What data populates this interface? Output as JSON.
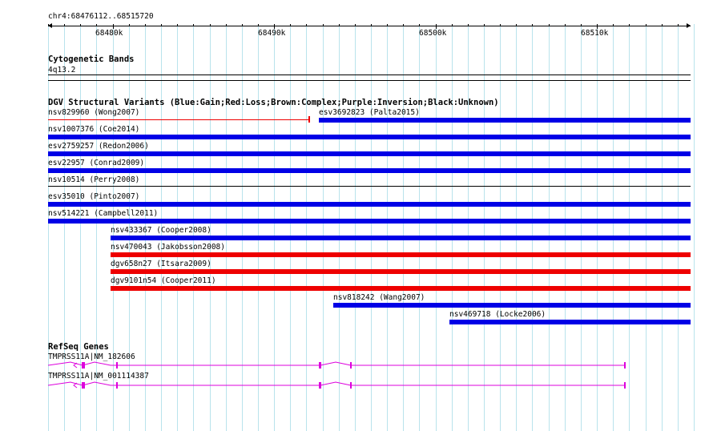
{
  "ruler": {
    "location": "chr4:68476112..68515720",
    "ticks": [
      "68480k",
      "68490k",
      "68500k",
      "68510k"
    ]
  },
  "cytoband": {
    "title": "Cytogenetic Bands",
    "band": "4q13.2"
  },
  "dgv": {
    "title": "DGV Structural Variants (Blue:Gain;Red:Loss;Brown:Complex;Purple:Inversion;Black:Unknown)",
    "colors": {
      "gain": "#0000e6",
      "loss": "#ee0000",
      "unknown": "#000000"
    },
    "variants": [
      {
        "label": "nsv829960 (Wong2007)",
        "type": "loss-thin"
      },
      {
        "label": "esv3692823 (Palta2015)",
        "type": "gain"
      },
      {
        "label": "nsv1007376 (Coe2014)",
        "type": "gain"
      },
      {
        "label": "esv2759257 (Redon2006)",
        "type": "gain"
      },
      {
        "label": "esv22957 (Conrad2009)",
        "type": "gain"
      },
      {
        "label": "nsv10514 (Perry2008)",
        "type": "unknown"
      },
      {
        "label": "esv35010 (Pinto2007)",
        "type": "gain"
      },
      {
        "label": "nsv514221 (Campbell2011)",
        "type": "gain"
      },
      {
        "label": "nsv433367 (Cooper2008)",
        "type": "gain"
      },
      {
        "label": "nsv470043 (Jakobsson2008)",
        "type": "loss"
      },
      {
        "label": "dgv658n27 (Itsara2009)",
        "type": "loss"
      },
      {
        "label": "dgv9101n54 (Cooper2011)",
        "type": "loss"
      },
      {
        "label": "nsv818242 (Wang2007)",
        "type": "gain"
      },
      {
        "label": "nsv469718 (Locke2006)",
        "type": "gain"
      }
    ]
  },
  "refseq": {
    "title": "RefSeq Genes",
    "color": "#dd00dd",
    "genes": [
      {
        "label": "TMPRSS11A|NM_182606"
      },
      {
        "label": "TMPRSS11A|NM_001114387"
      }
    ]
  }
}
